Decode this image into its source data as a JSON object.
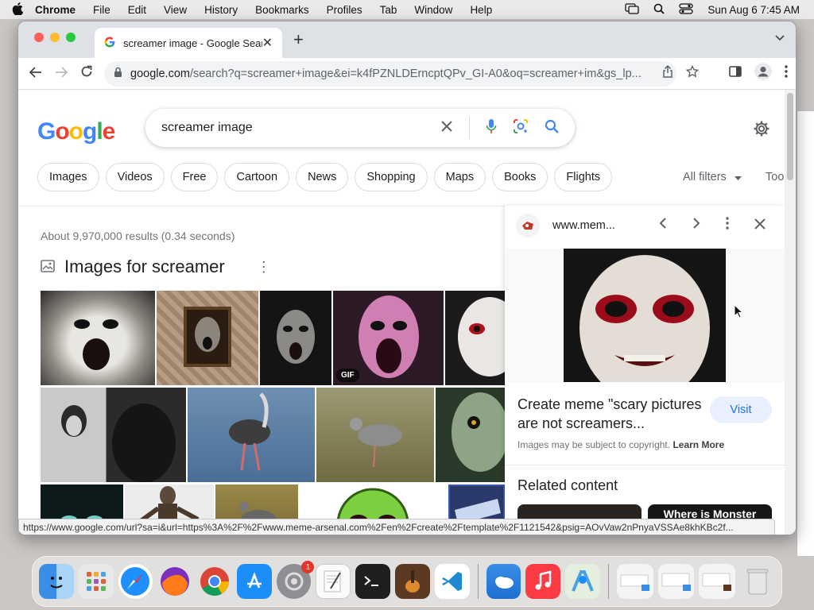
{
  "menubar": {
    "app": "Chrome",
    "items": [
      "File",
      "Edit",
      "View",
      "History",
      "Bookmarks",
      "Profiles",
      "Tab",
      "Window",
      "Help"
    ],
    "clock": "Sun Aug 6  7:45 AM"
  },
  "browser": {
    "tab_title": "screamer image - Google Sear",
    "url_host": "google.com",
    "url_path": "/search?q=screamer+image&ei=k4fPZNLDErncptQPv_GI-A0&oq=screamer+im&gs_lp..."
  },
  "google": {
    "logo": "Google",
    "query": "screamer image",
    "chips": [
      "Images",
      "Videos",
      "Free",
      "Cartoon",
      "News",
      "Shopping",
      "Maps",
      "Books",
      "Flights"
    ],
    "all_filters": "All filters",
    "tools": "Tool",
    "stats": "About 9,970,000 results (0.34 seconds)",
    "images_heading": "Images for screamer",
    "gif_label": "GIF"
  },
  "panel": {
    "source": "www.mem...",
    "title": "Create meme \"scary pictures are not screamers...",
    "visit": "Visit",
    "copyright": "Images may be subject to copyright.",
    "learn_more": "Learn More",
    "related": "Related content",
    "related_card2": "Where is Monster"
  },
  "statusbar": {
    "url": "https://www.google.com/url?sa=i&url=https%3A%2F%2Fwww.meme-arsenal.com%2Fen%2Fcreate%2Ftemplate%2F1121542&psig=AOvVaw2nPnyaVSSAe8khKBc2f..."
  },
  "dock": {
    "settings_badge": "1"
  },
  "colors": {
    "google_blue": "#4285F4",
    "google_red": "#EA4335",
    "google_yellow": "#FBBC05",
    "google_green": "#34A853",
    "link_blue": "#1a73e8"
  }
}
